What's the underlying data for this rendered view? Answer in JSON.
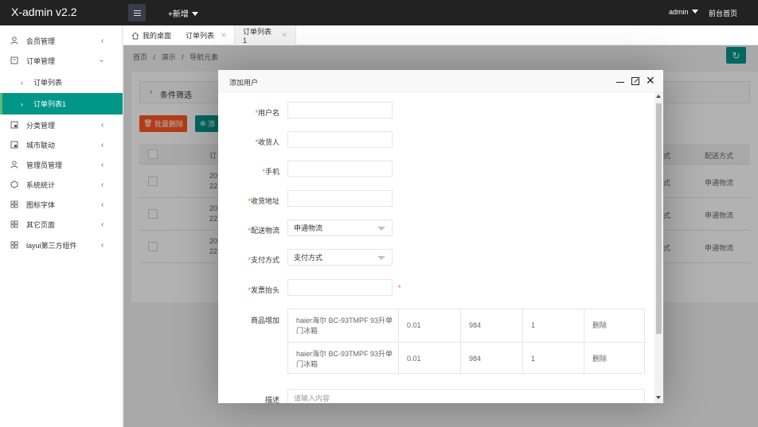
{
  "header": {
    "logo": "X-admin v2.2",
    "add_new": "+新增",
    "user": "admin",
    "front_page": "前台首页"
  },
  "sidebar": {
    "items": [
      {
        "label": "会员管理",
        "icon": "user-icon"
      },
      {
        "label": "订单管理",
        "icon": "order-icon"
      },
      {
        "label": "订单列表",
        "icon": "chevron-right-icon"
      },
      {
        "label": "订单列表1",
        "icon": "chevron-right-icon"
      },
      {
        "label": "分类管理",
        "icon": "category-icon"
      },
      {
        "label": "城市联动",
        "icon": "city-icon"
      },
      {
        "label": "管理员管理",
        "icon": "admin-icon"
      },
      {
        "label": "系统统计",
        "icon": "stats-icon"
      },
      {
        "label": "图标字体",
        "icon": "font-icon"
      },
      {
        "label": "其它页面",
        "icon": "pages-icon"
      },
      {
        "label": "layui第三方组件",
        "icon": "component-icon"
      }
    ]
  },
  "tabs": [
    {
      "label": "我的桌面"
    },
    {
      "label": "订单列表"
    },
    {
      "label": "订单列表1"
    }
  ],
  "breadcrumb": {
    "home": "首页",
    "demo": "演示",
    "current": "导航元素"
  },
  "main": {
    "filter_label": "条件筛选",
    "batch_delete": "批量删除",
    "add_label": "添",
    "header_order": "订",
    "header_method": "式",
    "header_delivery": "配送方式",
    "rows": [
      {
        "num_a": "20",
        "num_b": "22",
        "method": "式",
        "delivery": "申通物流"
      },
      {
        "num_a": "20",
        "num_b": "22",
        "method": "式",
        "delivery": "申通物流"
      },
      {
        "num_a": "20",
        "num_b": "22",
        "method": "式",
        "delivery": "申通物流"
      }
    ]
  },
  "modal": {
    "title": "添加用户",
    "fields": {
      "username": {
        "label": "用户名"
      },
      "receiver": {
        "label": "收货人"
      },
      "phone": {
        "label": "手机"
      },
      "address": {
        "label": "收货地址"
      },
      "delivery": {
        "label": "配送物流",
        "value": "申通物流"
      },
      "payment": {
        "label": "支付方式",
        "value": "支付方式"
      },
      "invoice": {
        "label": "发票抬头"
      }
    },
    "required_mark": "*",
    "goods_label": "商品增加",
    "goods": [
      {
        "name": "haier海尔 BC-93TMPF 93升单门冰箱",
        "price": "0.01",
        "stock": "984",
        "qty": "1",
        "action": "删除"
      },
      {
        "name": "haier海尔 BC-93TMPF 93升单门冰箱",
        "price": "0.01",
        "stock": "984",
        "qty": "1",
        "action": "删除"
      }
    ],
    "desc_label": "描述",
    "desc_placeholder": "请输入内容"
  },
  "colors": {
    "accent": "#009688",
    "danger": "#ff5722",
    "topbar": "#222222"
  }
}
